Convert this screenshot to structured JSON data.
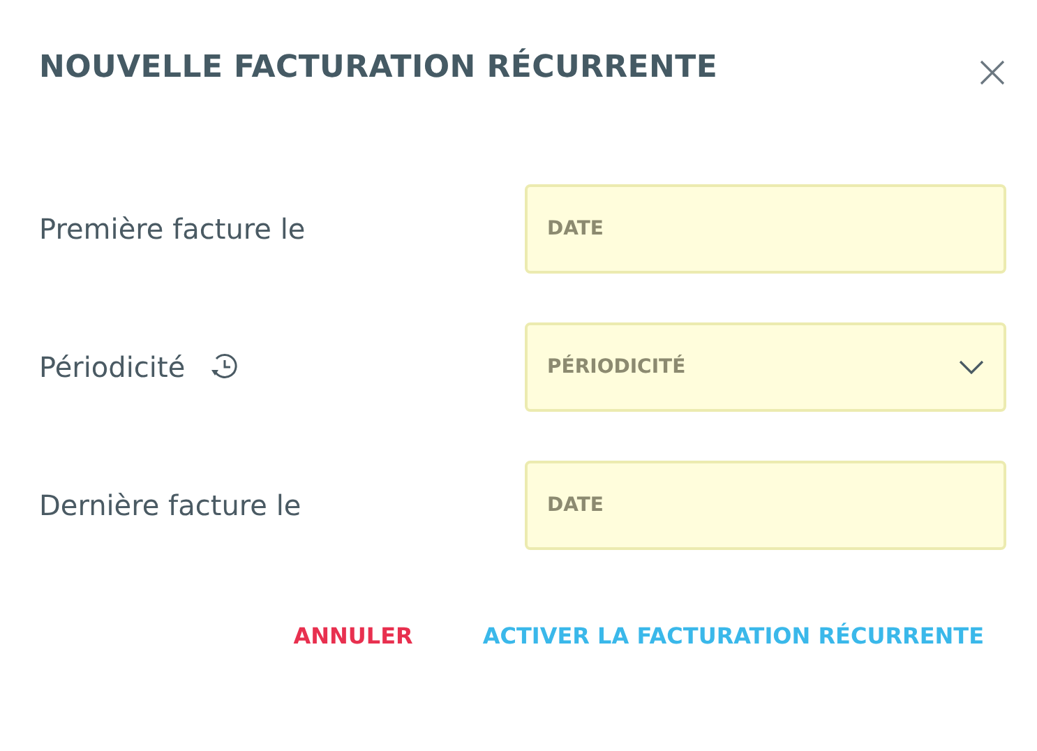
{
  "dialog": {
    "title": "NOUVELLE FACTURATION RÉCURRENTE"
  },
  "rows": [
    {
      "label": "Première facture le",
      "history_icon": false,
      "field": {
        "kind": "date",
        "placeholder": "DATE"
      }
    },
    {
      "label": "Périodicité",
      "history_icon": true,
      "field": {
        "kind": "select",
        "placeholder": "PÉRIODICITÉ"
      }
    },
    {
      "label": "Dernière facture le",
      "history_icon": false,
      "field": {
        "kind": "date",
        "placeholder": "DATE"
      }
    }
  ],
  "buttons": [
    {
      "label": "ANNULER",
      "kind": "cancel"
    },
    {
      "label": "ACTIVER LA FACTURATION RÉCURRENTE",
      "kind": "confirm"
    }
  ]
}
